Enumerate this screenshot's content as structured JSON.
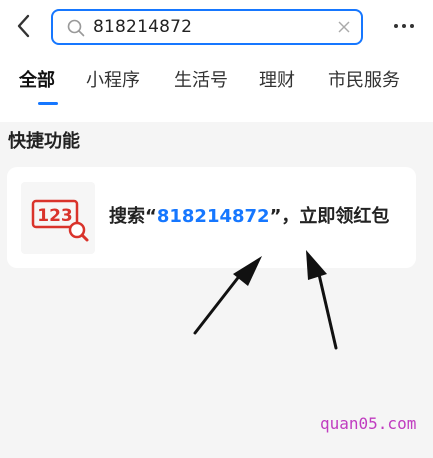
{
  "search": {
    "value": "818214872"
  },
  "tabs": [
    {
      "label": "全部",
      "active": true
    },
    {
      "label": "小程序",
      "active": false
    },
    {
      "label": "生活号",
      "active": false
    },
    {
      "label": "理财",
      "active": false
    },
    {
      "label": "市民服务",
      "active": false
    }
  ],
  "section": {
    "title": "快捷功能"
  },
  "card": {
    "icon_text": "123",
    "prefix": "搜索“",
    "query": "818214872",
    "suffix": "”，立即领红包"
  },
  "watermark": "quan05.com",
  "icons": {
    "back": "chevron-left-icon",
    "search": "search-icon",
    "clear": "close-icon",
    "more": "more-dots-icon",
    "card": "number-search-icon"
  },
  "colors": {
    "accent": "#1677ff",
    "card_icon": "#d9332b",
    "watermark": "#c03cc0"
  }
}
